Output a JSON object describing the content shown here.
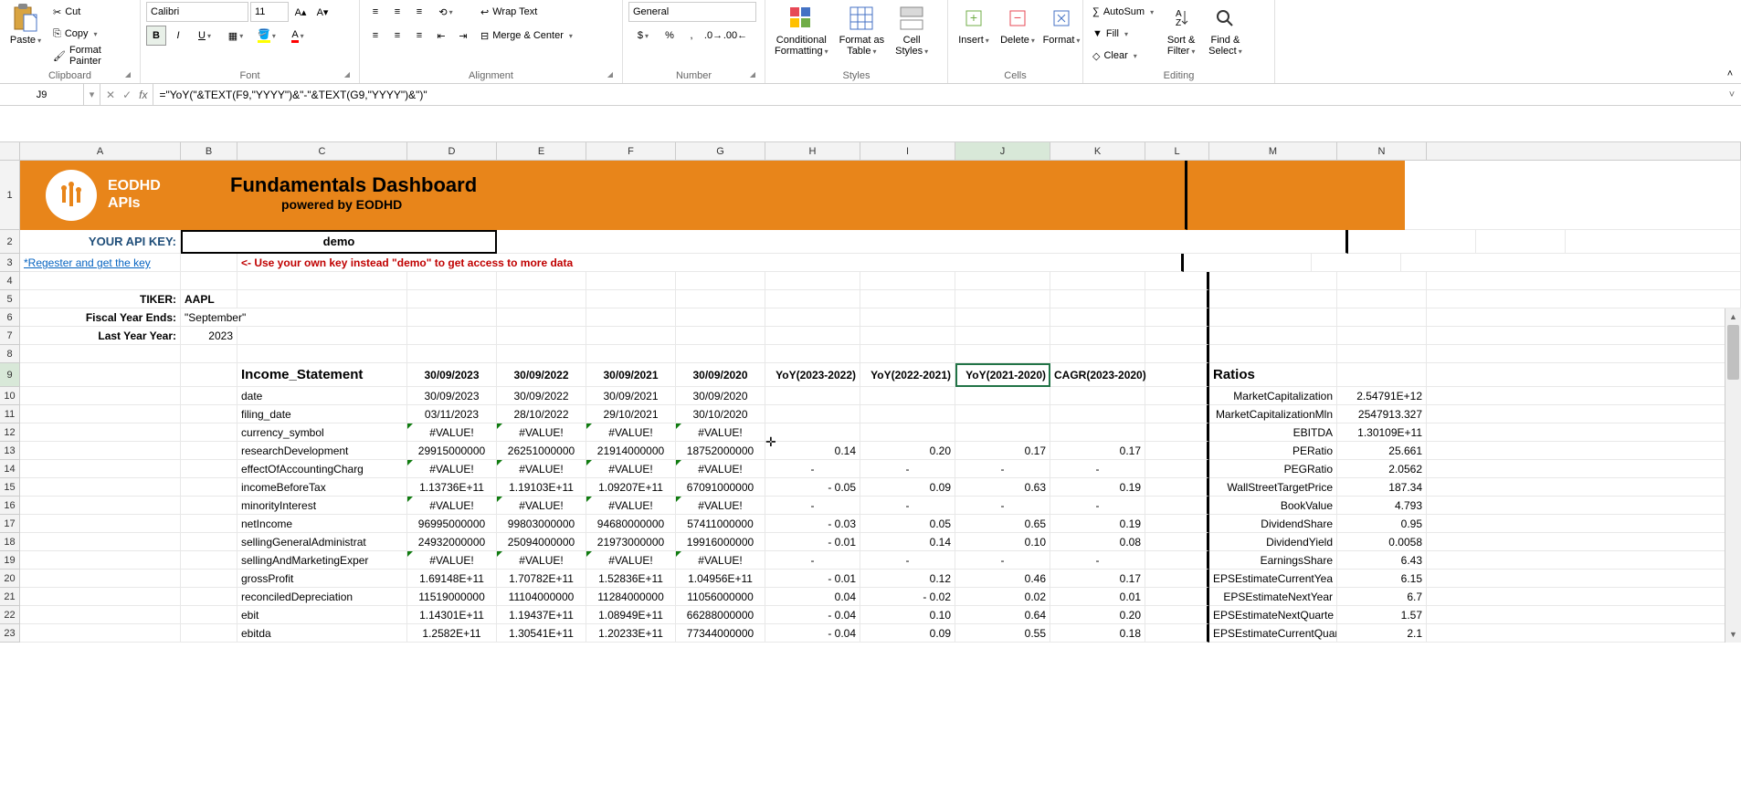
{
  "ribbon": {
    "clipboard": {
      "label": "Clipboard",
      "paste": "Paste",
      "cut": "Cut",
      "copy": "Copy",
      "format_painter": "Format Painter"
    },
    "font": {
      "label": "Font",
      "name": "Calibri",
      "size": "11"
    },
    "alignment": {
      "label": "Alignment",
      "wrap": "Wrap Text",
      "merge": "Merge & Center"
    },
    "number": {
      "label": "Number",
      "format": "General"
    },
    "styles": {
      "label": "Styles",
      "cond": "Conditional\nFormatting",
      "table": "Format as\nTable",
      "cell": "Cell\nStyles"
    },
    "cells": {
      "label": "Cells",
      "insert": "Insert",
      "delete": "Delete",
      "format": "Format"
    },
    "editing": {
      "label": "Editing",
      "autosum": "AutoSum",
      "fill": "Fill",
      "clear": "Clear",
      "sort": "Sort &\nFilter",
      "find": "Find &\nSelect"
    }
  },
  "formula_bar": {
    "cell_ref": "J9",
    "formula": "=\"YoY(\"&TEXT(F9,\"YYYY\")&\"-\"&TEXT(G9,\"YYYY\")&\")\""
  },
  "columns": [
    "A",
    "B",
    "C",
    "D",
    "E",
    "F",
    "G",
    "H",
    "I",
    "J",
    "K",
    "L",
    "M",
    "N"
  ],
  "selected_col": "J",
  "selected_row": "9",
  "dashboard": {
    "title": "Fundamentals Dashboard",
    "subtitle": "powered by EODHD",
    "logo_line1": "EODHD",
    "logo_line2": "APIs"
  },
  "meta": {
    "api_key_label": "YOUR API KEY:",
    "api_key_value": "demo",
    "register_link": "*Regester and get the key",
    "warning": "<- Use your own key instead \"demo\" to get access to more data",
    "ticker_label": "TIKER:",
    "ticker_value": "AAPL",
    "fye_label": "Fiscal Year Ends:",
    "fye_value": "\"September\"",
    "lyy_label": "Last Year Year:",
    "lyy_value": "2023"
  },
  "income_statement": {
    "title": "Income_Statement",
    "date_headers": [
      "30/09/2023",
      "30/09/2022",
      "30/09/2021",
      "30/09/2020"
    ],
    "yoy_headers": [
      "YoY(2023-2022)",
      "YoY(2022-2021)",
      "YoY(2021-2020)"
    ],
    "cagr_header": "CAGR(2023-2020)",
    "rows": [
      {
        "label": "date",
        "d": [
          "30/09/2023",
          "30/09/2022",
          "30/09/2021",
          "30/09/2020"
        ],
        "yoy": [
          "",
          "",
          ""
        ],
        "cagr": ""
      },
      {
        "label": "filing_date",
        "d": [
          "03/11/2023",
          "28/10/2022",
          "29/10/2021",
          "30/10/2020"
        ],
        "yoy": [
          "",
          "",
          ""
        ],
        "cagr": ""
      },
      {
        "label": "currency_symbol",
        "d": [
          "#VALUE!",
          "#VALUE!",
          "#VALUE!",
          "#VALUE!"
        ],
        "yoy": [
          "",
          "",
          ""
        ],
        "cagr": "",
        "err": true
      },
      {
        "label": "researchDevelopment",
        "d": [
          "29915000000",
          "26251000000",
          "21914000000",
          "18752000000"
        ],
        "yoy": [
          "0.14",
          "0.20",
          "0.17"
        ],
        "cagr": "0.17"
      },
      {
        "label": "effectOfAccountingCharg",
        "d": [
          "#VALUE!",
          "#VALUE!",
          "#VALUE!",
          "#VALUE!"
        ],
        "yoy": [
          "-",
          "-",
          "-"
        ],
        "cagr": "-",
        "err": true,
        "dash_center": true
      },
      {
        "label": "incomeBeforeTax",
        "d": [
          "1.13736E+11",
          "1.19103E+11",
          "1.09207E+11",
          "67091000000"
        ],
        "yoy": [
          "-           0.05",
          "0.09",
          "0.63"
        ],
        "cagr": "0.19"
      },
      {
        "label": "minorityInterest",
        "d": [
          "#VALUE!",
          "#VALUE!",
          "#VALUE!",
          "#VALUE!"
        ],
        "yoy": [
          "-",
          "-",
          "-"
        ],
        "cagr": "-",
        "err": true,
        "dash_center": true
      },
      {
        "label": "netIncome",
        "d": [
          "96995000000",
          "99803000000",
          "94680000000",
          "57411000000"
        ],
        "yoy": [
          "-           0.03",
          "0.05",
          "0.65"
        ],
        "cagr": "0.19"
      },
      {
        "label": "sellingGeneralAdministrat",
        "d": [
          "24932000000",
          "25094000000",
          "21973000000",
          "19916000000"
        ],
        "yoy": [
          "-           0.01",
          "0.14",
          "0.10"
        ],
        "cagr": "0.08"
      },
      {
        "label": "sellingAndMarketingExper",
        "d": [
          "#VALUE!",
          "#VALUE!",
          "#VALUE!",
          "#VALUE!"
        ],
        "yoy": [
          "-",
          "-",
          "-"
        ],
        "cagr": "-",
        "err": true,
        "dash_center": true
      },
      {
        "label": "grossProfit",
        "d": [
          "1.69148E+11",
          "1.70782E+11",
          "1.52836E+11",
          "1.04956E+11"
        ],
        "yoy": [
          "-           0.01",
          "0.12",
          "0.46"
        ],
        "cagr": "0.17"
      },
      {
        "label": "reconciledDepreciation",
        "d": [
          "11519000000",
          "11104000000",
          "11284000000",
          "11056000000"
        ],
        "yoy": [
          "0.04",
          "-           0.02",
          "0.02"
        ],
        "cagr": "0.01"
      },
      {
        "label": "ebit",
        "d": [
          "1.14301E+11",
          "1.19437E+11",
          "1.08949E+11",
          "66288000000"
        ],
        "yoy": [
          "-           0.04",
          "0.10",
          "0.64"
        ],
        "cagr": "0.20"
      },
      {
        "label": "ebitda",
        "d": [
          "1.2582E+11",
          "1.30541E+11",
          "1.20233E+11",
          "77344000000"
        ],
        "yoy": [
          "-           0.04",
          "0.09",
          "0.55"
        ],
        "cagr": "0.18"
      }
    ]
  },
  "ratios": {
    "title": "Ratios",
    "items": [
      {
        "label": "MarketCapitalization",
        "value": "2.54791E+12"
      },
      {
        "label": "MarketCapitalizationMln",
        "value": "2547913.327"
      },
      {
        "label": "EBITDA",
        "value": "1.30109E+11"
      },
      {
        "label": "PERatio",
        "value": "25.661"
      },
      {
        "label": "PEGRatio",
        "value": "2.0562"
      },
      {
        "label": "WallStreetTargetPrice",
        "value": "187.34"
      },
      {
        "label": "BookValue",
        "value": "4.793"
      },
      {
        "label": "DividendShare",
        "value": "0.95"
      },
      {
        "label": "DividendYield",
        "value": "0.0058"
      },
      {
        "label": "EarningsShare",
        "value": "6.43"
      },
      {
        "label": "EPSEstimateCurrentYea",
        "value": "6.15"
      },
      {
        "label": "EPSEstimateNextYear",
        "value": "6.7"
      },
      {
        "label": "EPSEstimateNextQuarte",
        "value": "1.57"
      },
      {
        "label": "EPSEstimateCurrentQuart",
        "value": "2.1"
      }
    ]
  },
  "cursor_icon": "✛"
}
